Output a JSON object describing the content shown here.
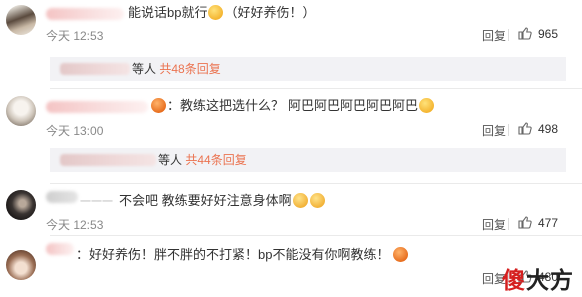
{
  "comments": [
    {
      "text_main": "能说话bp就行",
      "text_tail": "（好好养伤！）",
      "time": "今天 12:53",
      "reply_label": "回复",
      "likes": "965",
      "sub": {
        "prefix": "等人",
        "count_text": "共48条回复"
      }
    },
    {
      "text_colon": "：教练这把选什么？",
      "text_tail": "阿巴阿巴阿巴阿巴阿巴",
      "time": "今天 13:00",
      "reply_label": "回复",
      "likes": "498",
      "sub": {
        "prefix": "等人",
        "count_text": "共44条回复"
      }
    },
    {
      "name_fragment": "一一一",
      "text_main": "不会吧 教练要好好注意身体啊",
      "time": "今天 12:53",
      "reply_label": "回复",
      "likes": "477"
    },
    {
      "text_main": "：好好养伤！胖不胖的不打紧！bp不能没有你啊教练！",
      "reply_label": "回复",
      "likes": "480"
    }
  ],
  "watermark": {
    "part1": "傻",
    "part2": "大方"
  },
  "icons": {
    "like": "thumbs-up-icon",
    "emoji_smile": "smile-emoji-icon",
    "emoji_sad": "sad-emoji-icon",
    "emoji_angry": "angry-emoji-icon"
  },
  "colors": {
    "accent": "#eb7350",
    "watermark_red": "#d51f1f"
  }
}
